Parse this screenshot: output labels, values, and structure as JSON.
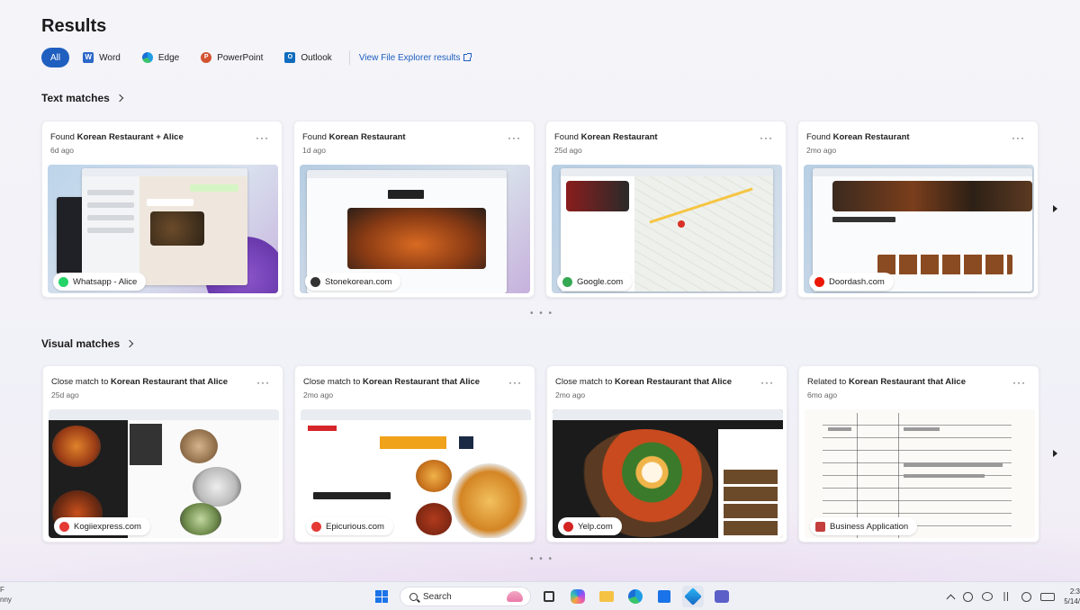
{
  "page": {
    "title": "Results"
  },
  "filters": {
    "items": [
      {
        "label": "All",
        "icon": "",
        "active": true
      },
      {
        "label": "Word",
        "icon": "word-icon"
      },
      {
        "label": "Edge",
        "icon": "edge-icon"
      },
      {
        "label": "PowerPoint",
        "icon": "powerpoint-icon"
      },
      {
        "label": "Outlook",
        "icon": "outlook-icon"
      }
    ],
    "explorer_link": "View File Explorer results"
  },
  "text_matches": {
    "title": "Text matches",
    "cards": [
      {
        "prefix": "Found",
        "query": "Korean Restaurant + Alice",
        "age": "6d ago",
        "source": "Whatsapp - Alice",
        "source_icon": "whatsapp-icon",
        "source_color": "#25d366"
      },
      {
        "prefix": "Found",
        "query": "Korean Restaurant",
        "age": "1d ago",
        "source": "Stonekorean.com",
        "source_icon": "stonekorean-icon",
        "source_color": "#333333"
      },
      {
        "prefix": "Found",
        "query": "Korean Restaurant",
        "age": "25d ago",
        "source": "Google.com",
        "source_icon": "map-pin-icon",
        "source_color": "#34a853"
      },
      {
        "prefix": "Found",
        "query": "Korean Restaurant",
        "age": "2mo ago",
        "source": "Doordash.com",
        "source_icon": "doordash-icon",
        "source_color": "#eb1700"
      }
    ],
    "pager": "• • •"
  },
  "visual_matches": {
    "title": "Visual matches",
    "cards": [
      {
        "prefix": "Close match to",
        "query": "Korean Restaurant that Alice",
        "age": "25d ago",
        "source": "Kogiiexpress.com",
        "source_icon": "kogiiexpress-icon",
        "source_color": "#e53935"
      },
      {
        "prefix": "Close match to",
        "query": "Korean Restaurant that Alice",
        "age": "2mo ago",
        "source": "Epicurious.com",
        "source_icon": "epicurious-icon",
        "source_color": "#e53935"
      },
      {
        "prefix": "Close match to",
        "query": "Korean Restaurant that Alice",
        "age": "2mo ago",
        "source": "Yelp.com",
        "source_icon": "yelp-icon",
        "source_color": "#d32323"
      },
      {
        "prefix": "Related to",
        "query": "Korean Restaurant that Alice",
        "age": "6mo ago",
        "source": "Business Application",
        "source_icon": "document-icon",
        "source_color": "#c43e3e"
      }
    ],
    "pager": "• • •"
  },
  "taskbar": {
    "left_line1": "F",
    "left_line2": "nny",
    "search_label": "Search",
    "time": "2:3",
    "date": "5/14/"
  }
}
